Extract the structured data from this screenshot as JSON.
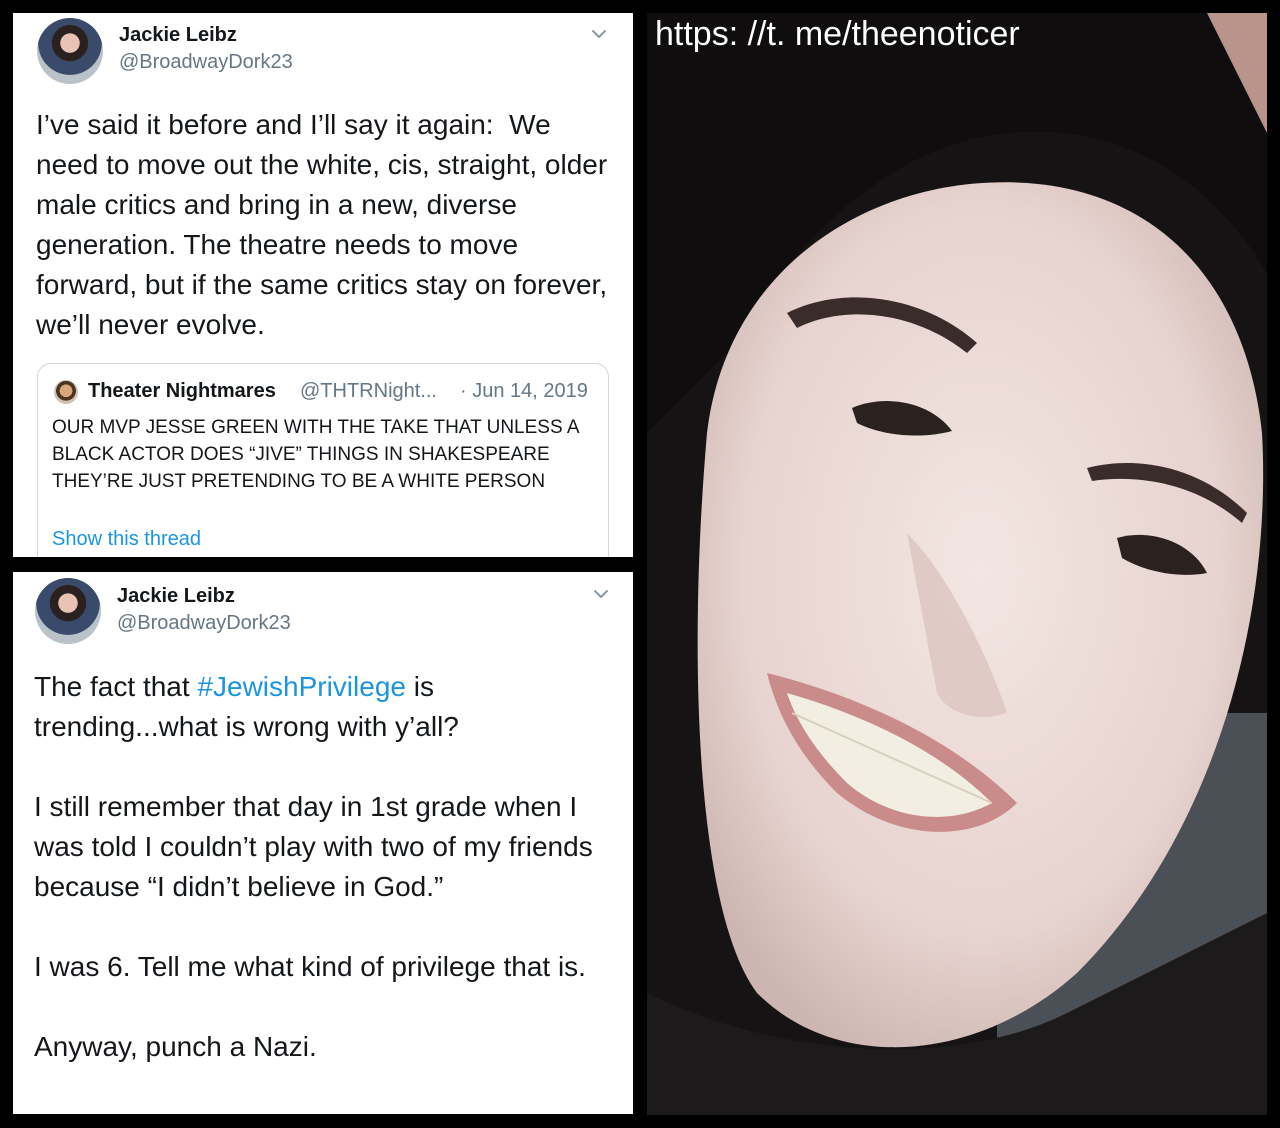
{
  "tweet1": {
    "name": "Jackie Leibz",
    "handle": "@BroadwayDork23",
    "text": "I’ve said it before and I’ll say it again:  We need to move out the white, cis, straight, older male critics and bring in a new, diverse generation. The theatre needs to move forward, but if the same critics stay on forever, we’ll never evolve.",
    "quote": {
      "name": "Theater Nightmares",
      "handle": "@THTRNight...",
      "date": "· Jun 14, 2019",
      "text": "OUR MVP JESSE GREEN WITH THE TAKE THAT UNLESS A BLACK ACTOR DOES “JIVE” THINGS IN SHAKESPEARE THEY’RE JUST PRETENDING TO BE A WHITE PERSON",
      "link": "Show this thread"
    }
  },
  "tweet2": {
    "name": "Jackie Leibz",
    "handle": "@BroadwayDork23",
    "text_before": "The fact that ",
    "hashtag": "#JewishPrivilege",
    "text_after": " is\ntrending...what is wrong with y’all?\n\nI still remember that day in 1st grade when I was told I couldn’t play with two of my friends because “I didn’t believe in God.”\n\nI was 6. Tell me what kind of privilege that is.\n\nAnyway, punch a Nazi."
  },
  "photo": {
    "watermark": "https: //t. me/theenoticer"
  },
  "colors": {
    "link": "#1b95e0",
    "text": "#14171a",
    "muted": "#657786"
  },
  "icons": [
    "chevron-down-icon",
    "avatar"
  ]
}
